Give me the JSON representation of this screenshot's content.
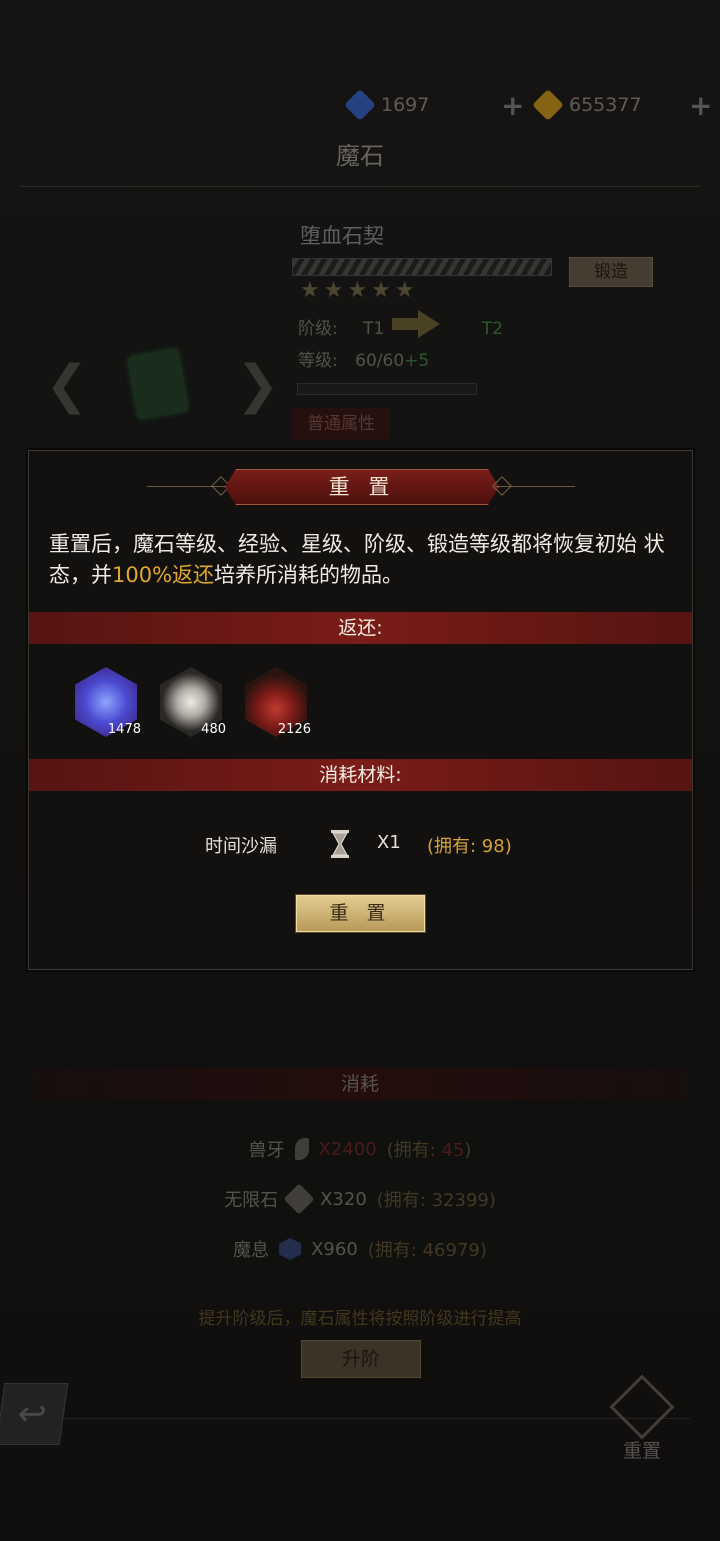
{
  "header": {
    "currencies": [
      {
        "icon": "blue-gem-icon",
        "value": "1697",
        "color": "#3e6bd0"
      },
      {
        "icon": "gold-gem-icon",
        "value": "655377",
        "color": "#d8a020"
      }
    ],
    "plus": "+",
    "title": "魔石"
  },
  "item": {
    "name": "堕血石契",
    "forge_label": "锻造",
    "stars": "★★★★★",
    "rank_label": "阶级:",
    "rank_from": "T1",
    "rank_to": "T2",
    "level_label": "等级:",
    "level_value": "60/60",
    "level_bonus": "+5",
    "attr_label": "普通属性"
  },
  "nav": {
    "prev": "❮",
    "next": "❯"
  },
  "modal": {
    "title": "重 置",
    "desc_a": "重置后，魔石等级、经验、星级、阶级、锻造等级都将恢复初始 状态，并",
    "desc_gold": "100%返还",
    "desc_b": "培养所消耗的物品。",
    "return_label": "返还:",
    "rewards": [
      {
        "icon": "blue-orb-icon",
        "count": "1478",
        "color": "#5a6ee0"
      },
      {
        "icon": "crystal-shard-icon",
        "count": "480",
        "color": "#c8c4bc"
      },
      {
        "icon": "red-ore-icon",
        "count": "2126",
        "color": "#a02a24"
      }
    ],
    "materials_label": "消耗材料:",
    "material": {
      "name": "时间沙漏",
      "icon": "hourglass-icon",
      "qty": "X1",
      "own": "(拥有: 98)"
    },
    "confirm_label": "重 置"
  },
  "consume": {
    "title": "消耗",
    "rows": [
      {
        "name": "兽牙",
        "icon": "fang-icon",
        "qty": "X2400",
        "own_prefix": "(拥有: ",
        "own_value": "45",
        "own_suffix": ")",
        "insufficient": true
      },
      {
        "name": "无限石",
        "icon": "stone-icon",
        "qty": "X320",
        "own_prefix": "(拥有: ",
        "own_value": "32399",
        "own_suffix": ")",
        "insufficient": false
      },
      {
        "name": "魔息",
        "icon": "magic-breath-icon",
        "qty": "X960",
        "own_prefix": "(拥有: ",
        "own_value": "46979",
        "own_suffix": ")",
        "insufficient": false
      }
    ],
    "hint": "提升阶级后，魔石属性将按照阶级进行提高",
    "advance_label": "升阶"
  },
  "footer": {
    "back_icon": "back-arrow-icon",
    "reset_label": "重置"
  }
}
